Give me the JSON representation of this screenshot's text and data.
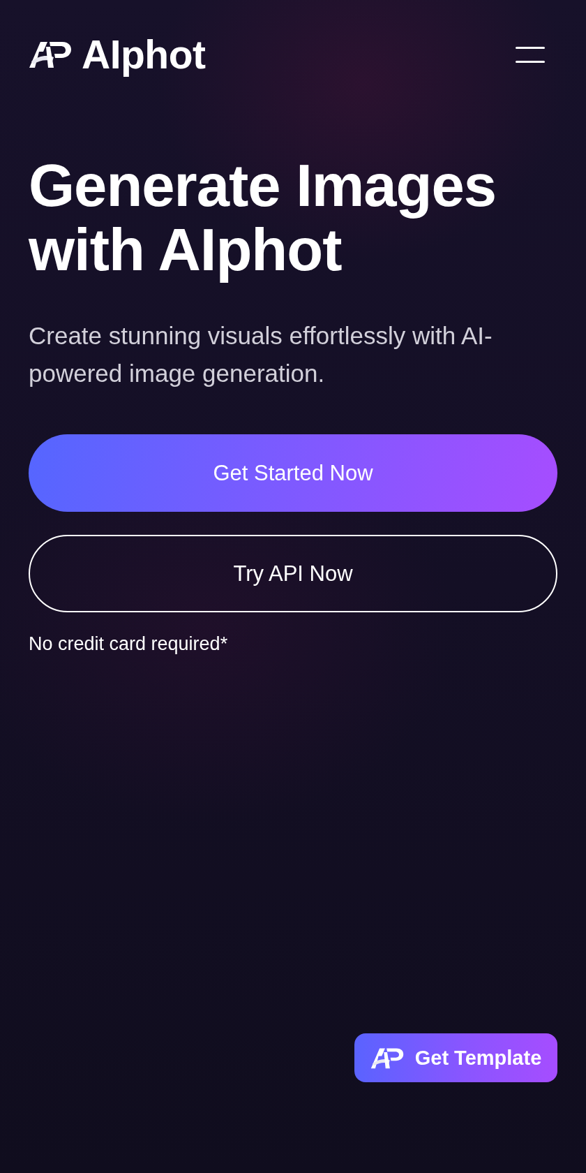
{
  "header": {
    "brand": "AIphot"
  },
  "hero": {
    "title": "Generate Images with AIphot",
    "subtitle": "Create stunning visuals effortlessly with AI-powered image generation.",
    "buttons": [
      {
        "label": "Get Started Now",
        "kind": "primary"
      },
      {
        "label": "Try API Now",
        "kind": "outline"
      }
    ],
    "note": "No credit card required*"
  },
  "floating_button": {
    "label": "Get Template"
  }
}
